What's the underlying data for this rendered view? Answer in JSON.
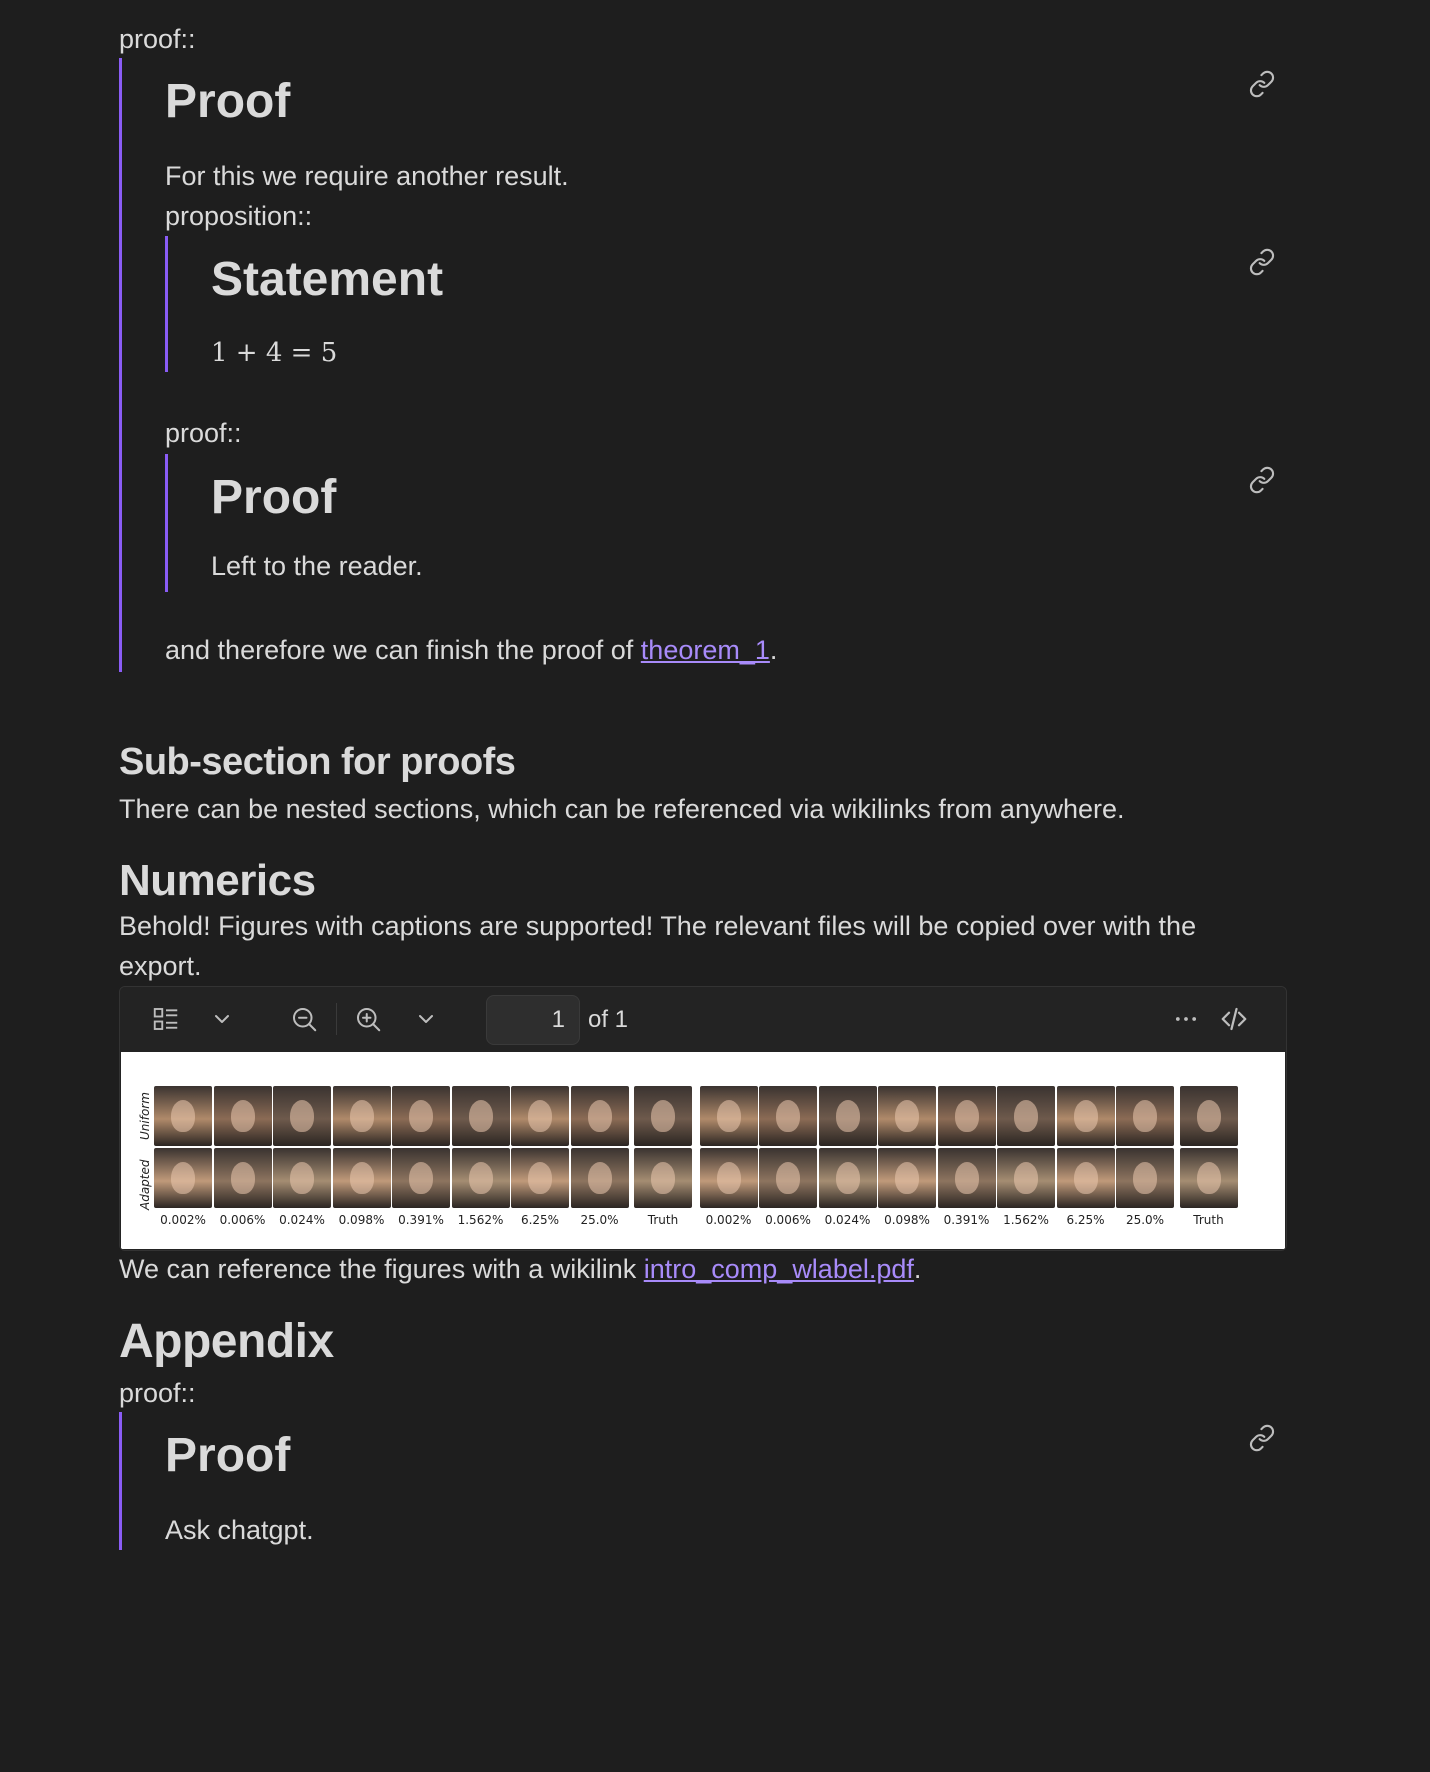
{
  "block1": {
    "label": "proof::",
    "title": "Proof",
    "text": "For this we require another result.",
    "nested_prop": {
      "label": "proposition::",
      "title": "Statement",
      "math": "1 + 4 = 5"
    },
    "nested_proof": {
      "label": "proof::",
      "title": "Proof",
      "text": "Left to the reader."
    },
    "closing_text": "and therefore we can finish the proof of ",
    "closing_link": "theorem_1",
    "closing_period": "."
  },
  "subsection": {
    "heading": "Sub-section for proofs",
    "text": "There can be nested sections, which can be referenced via wikilinks from anywhere."
  },
  "numerics": {
    "heading": "Numerics",
    "text": "Behold! Figures with captions are supported! The relevant files will be copied over with the export."
  },
  "pdf": {
    "page_value": "1",
    "page_of": "of 1",
    "row_labels": [
      "Uniform",
      "Adapted"
    ],
    "col_labels": [
      "0.002%",
      "0.006%",
      "0.024%",
      "0.098%",
      "0.391%",
      "1.562%",
      "6.25%",
      "25.0%",
      "Truth",
      "0.002%",
      "0.006%",
      "0.024%",
      "0.098%",
      "0.391%",
      "1.562%",
      "6.25%",
      "25.0%",
      "Truth"
    ]
  },
  "figref": {
    "text": "We can reference the figures with a wikilink ",
    "link": "intro_comp_wlabel.pdf",
    "period": "."
  },
  "appendix": {
    "heading": "Appendix",
    "proof_label": "proof::",
    "proof_title": "Proof",
    "proof_text": "Ask chatgpt."
  },
  "colors": {
    "accent": "#8a5cf5",
    "link": "#a88bfa",
    "background": "#1e1e1e",
    "text": "#dadada"
  }
}
